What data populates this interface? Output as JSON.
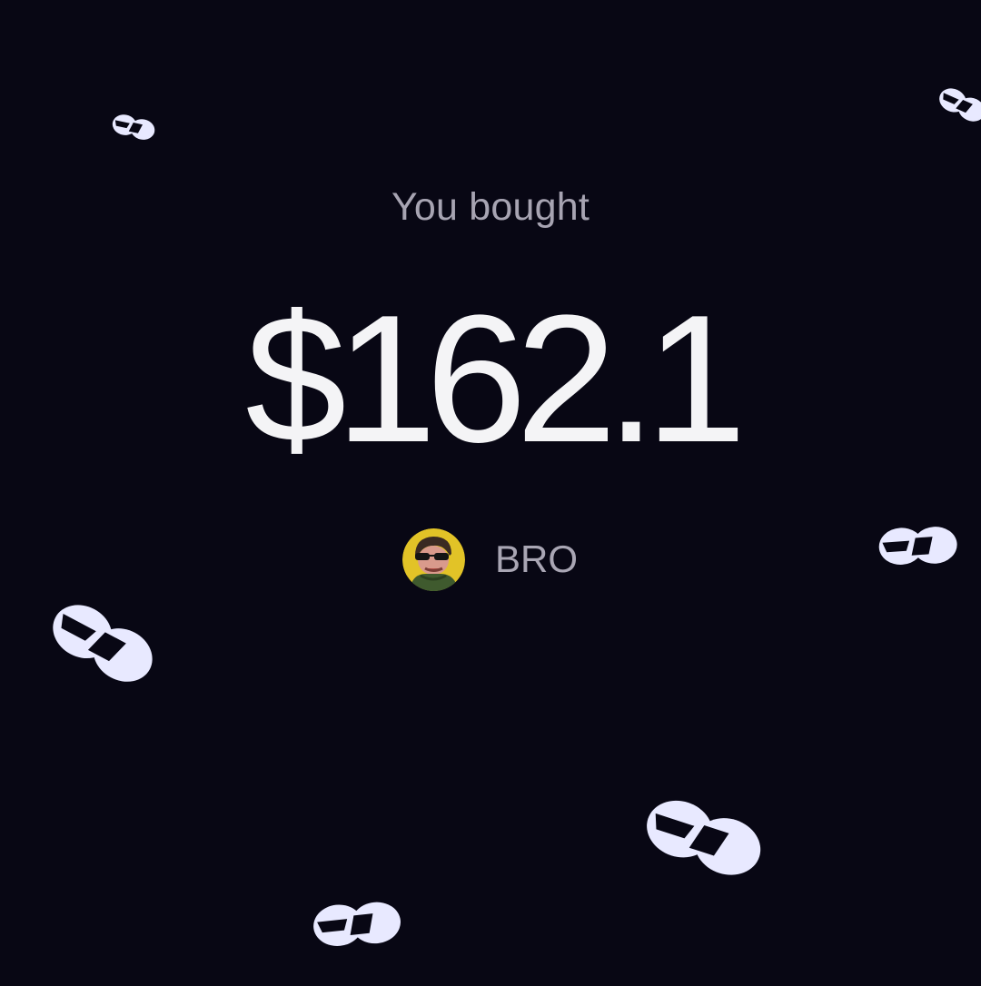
{
  "purchase": {
    "heading": "You bought",
    "amount": "$162.1"
  },
  "token": {
    "symbol": "BRO",
    "avatar_icon": "cartoon-character-avatar-icon"
  },
  "decorations": {
    "confetti_icon": "logo-mark-icon",
    "confetti_color": "#e8e9ff"
  },
  "colors": {
    "background": "#080714",
    "amount": "#f4f4f6",
    "muted": "#a7a4b2"
  }
}
